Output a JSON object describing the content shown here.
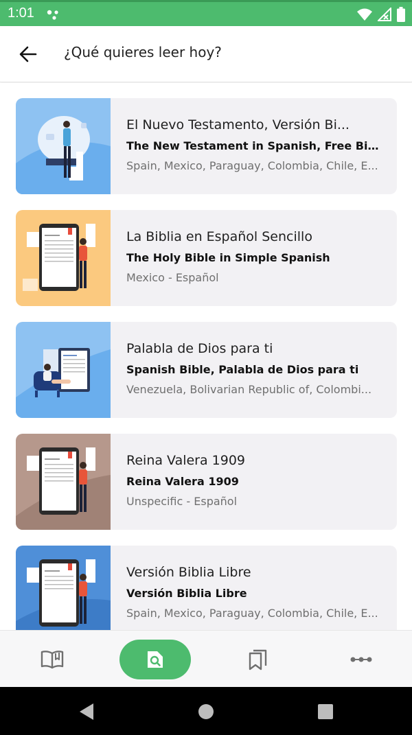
{
  "status_bar": {
    "time": "1:01",
    "background": "#4dbb6e"
  },
  "app_bar": {
    "title": "¿Qué quieres leer hoy?",
    "back_icon": "arrow-left-icon"
  },
  "bibles": [
    {
      "title": "El Nuevo Testamento, Versión Bi...",
      "subtitle": "The New Testament in Spanish, Free Bibl...",
      "meta": "Spain, Mexico, Paraguay, Colombia, Chile, E...",
      "thumb_color": "#8ec2f2",
      "thumb_icon": "reader-illustration"
    },
    {
      "title": "La Biblia en Español Sencillo",
      "subtitle": "The Holy Bible in Simple Spanish",
      "meta": "Mexico - Español",
      "thumb_color": "#fbc97f",
      "thumb_icon": "tablet-reader-illustration"
    },
    {
      "title": "Palabla de Dios para ti",
      "subtitle": "Spanish Bible, Palabla de Dios para ti",
      "meta": "Venezuela, Bolivarian Republic of, Colombi...",
      "thumb_color": "#8ec2f2",
      "thumb_icon": "armchair-reader-illustration"
    },
    {
      "title": "Reina Valera 1909",
      "subtitle": "Reina Valera 1909",
      "meta": "Unspecific - Español",
      "thumb_color": "#b6988c",
      "thumb_icon": "tablet-reader-illustration"
    },
    {
      "title": "Versión Biblia Libre",
      "subtitle": "Versión Biblia Libre",
      "meta": "Spain, Mexico, Paraguay, Colombia, Chile, E...",
      "thumb_color": "#4f8fd8",
      "thumb_icon": "tablet-reader-illustration"
    }
  ],
  "bottom_nav": [
    {
      "icon": "open-book-icon",
      "active": false
    },
    {
      "icon": "search-document-icon",
      "active": true
    },
    {
      "icon": "bookmarks-icon",
      "active": false
    },
    {
      "icon": "more-icon",
      "active": false
    }
  ],
  "system_nav": {
    "back_icon": "triangle-back-icon",
    "home_icon": "circle-home-icon",
    "recents_icon": "square-recents-icon"
  },
  "colors": {
    "accent": "#4dbb6e",
    "card_bg": "#f2f1f4",
    "meta_text": "#6f6f6f"
  }
}
